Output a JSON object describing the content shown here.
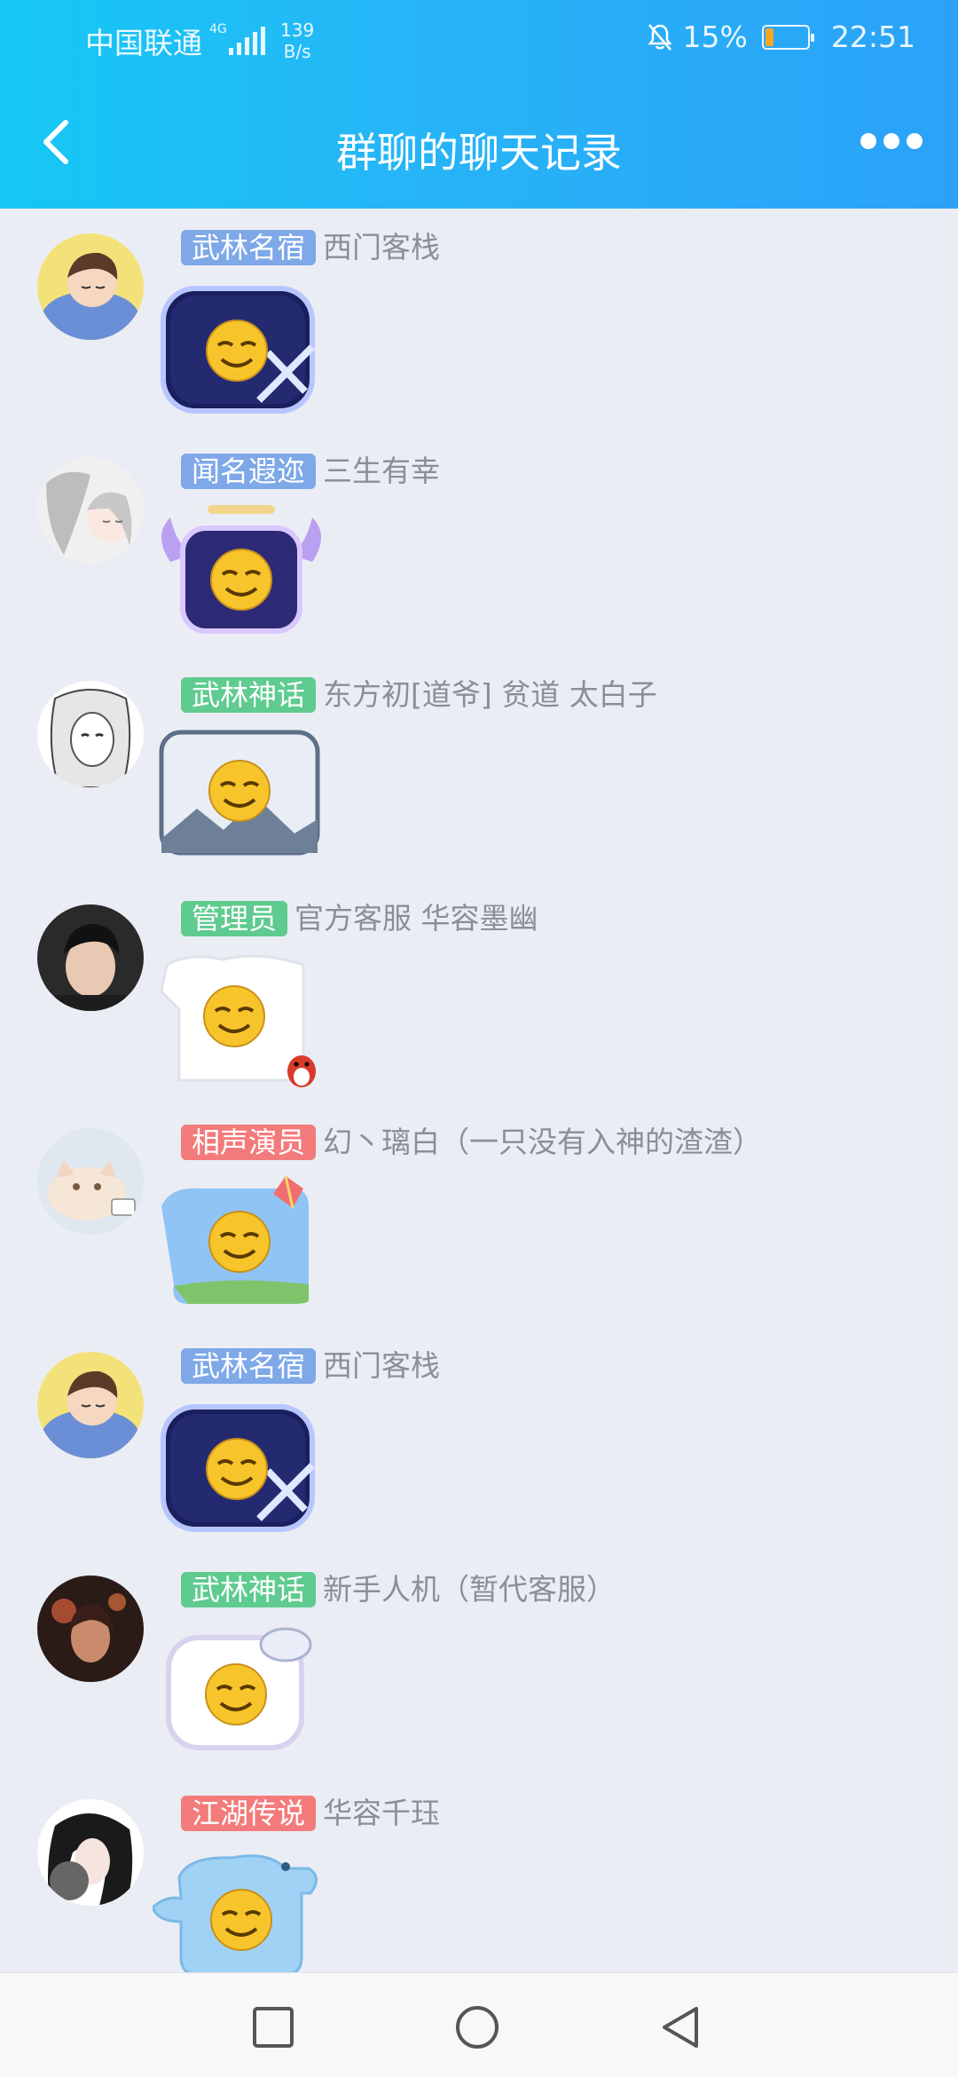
{
  "status_bar": {
    "carrier": "中国联通",
    "network": "4G",
    "speed_value": "139",
    "speed_unit": "B/s",
    "battery_percent": "15%",
    "time": "22:51"
  },
  "header": {
    "title": "群聊的聊天记录"
  },
  "messages": [
    {
      "badge": "武林名宿",
      "badge_color": "#7ea8e8",
      "nickname": "西门客栈",
      "avatar": "sleeping-boy-avatar",
      "sticker": "night-sword-emoji-sticker"
    },
    {
      "badge": "闻名遐迩",
      "badge_color": "#7ea8e8",
      "nickname": "三生有幸",
      "avatar": "couple-sketch-avatar",
      "sticker": "angel-wings-emoji-sticker"
    },
    {
      "badge": "武林神话",
      "badge_color": "#5fcb8f",
      "nickname": "东方初[道爷]   贫道    太白子",
      "avatar": "manga-girl-avatar",
      "sticker": "mountain-landscape-emoji-sticker"
    },
    {
      "badge": "管理员",
      "badge_color": "#5fcb8f",
      "nickname": "官方客服  华容墨幽",
      "avatar": "young-man-avatar",
      "sticker": "snow-penguin-emoji-sticker"
    },
    {
      "badge": "相声演员",
      "badge_color": "#f47b7b",
      "nickname": "幻丶璃白（一只没有入神的渣渣）",
      "avatar": "cat-avatar",
      "sticker": "kite-sky-emoji-sticker"
    },
    {
      "badge": "武林名宿",
      "badge_color": "#7ea8e8",
      "nickname": "西门客栈",
      "avatar": "sleeping-boy-avatar",
      "sticker": "night-sword-emoji-sticker"
    },
    {
      "badge": "武林神话",
      "badge_color": "#5fcb8f",
      "nickname": "新手人机（暂代客服）",
      "avatar": "lantern-girl-avatar",
      "sticker": "moon-bubble-emoji-sticker"
    },
    {
      "badge": "江湖传说",
      "badge_color": "#f47b7b",
      "nickname": "华容千珏",
      "avatar": "black-hair-girl-avatar",
      "sticker": "blue-whale-emoji-sticker"
    }
  ],
  "system_nav": [
    "recent-apps-icon",
    "home-icon",
    "back-triangle-icon"
  ]
}
